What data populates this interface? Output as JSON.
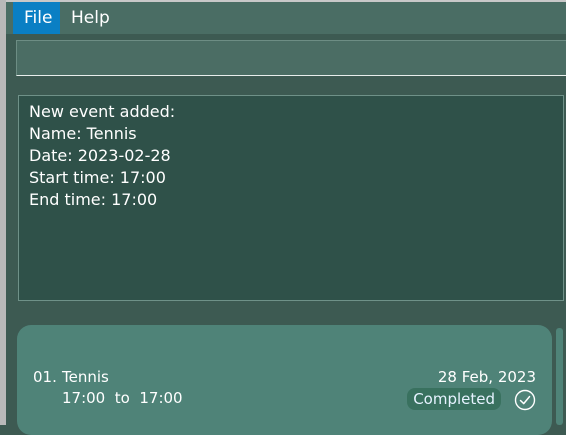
{
  "menu": {
    "items": [
      {
        "label": "File"
      },
      {
        "label": "Help"
      }
    ]
  },
  "command": {
    "value": "",
    "placeholder": ""
  },
  "result": {
    "lines": [
      "New event added:",
      "Name: Tennis",
      "Date: 2023-02-28",
      "Start time: 17:00",
      "End time: 17:00"
    ]
  },
  "events": [
    {
      "index": "01.",
      "name": "Tennis",
      "time_range": "17:00  to  17:00",
      "date": "28 Feb, 2023",
      "status": "Completed",
      "status_icon": "check-circle-icon"
    }
  ],
  "colors": {
    "background": "#3d5a52",
    "menubar": "#4a6d64",
    "menu_active": "#0a7fc4",
    "result_background": "#2f5149",
    "card_background": "#4f8378",
    "badge_background": "#39715f"
  }
}
